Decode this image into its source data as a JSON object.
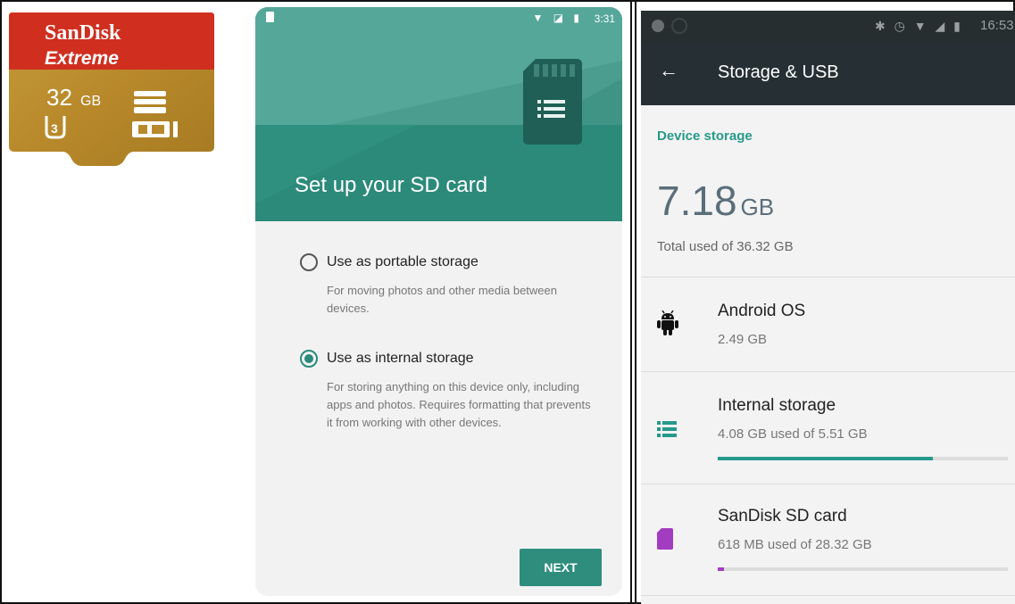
{
  "sdcard": {
    "brand": "SanDisk",
    "model": "Extreme",
    "capacity": "32",
    "capacity_unit": "GB",
    "uhs_class": "3",
    "format_logo": "microSDHC I"
  },
  "setup_screen": {
    "status_time": "3:31",
    "title": "Set up your SD card",
    "options": [
      {
        "label": "Use as portable storage",
        "description": "For moving photos and other media between devices.",
        "selected": false
      },
      {
        "label": "Use as internal storage",
        "description": "For storing anything on this device only, including apps and photos. Requires formatting that prevents it from working with other devices.",
        "selected": true
      }
    ],
    "next_label": "NEXT",
    "colors": {
      "header": "#4a9d8f",
      "accent": "#2e8d7d"
    }
  },
  "storage_screen": {
    "status_time": "16:53",
    "title": "Storage & USB",
    "section_title": "Device storage",
    "used_amount": "7.18",
    "used_unit": "GB",
    "total_caption": "Total used of 36.32 GB",
    "items": [
      {
        "icon": "android-icon",
        "label": "Android OS",
        "detail": "2.49 GB"
      },
      {
        "icon": "storage-list-icon",
        "label": "Internal storage",
        "detail": "4.08 GB used of 5.51 GB",
        "fraction": 0.74,
        "bar_color": "#26998a"
      },
      {
        "icon": "sd-card-icon",
        "label": "SanDisk SD card",
        "detail": "618 MB used of 28.32 GB",
        "fraction": 0.02,
        "bar_color": "#a23cc0"
      }
    ],
    "colors": {
      "toolbar": "#263034",
      "section": "#26998a"
    }
  }
}
